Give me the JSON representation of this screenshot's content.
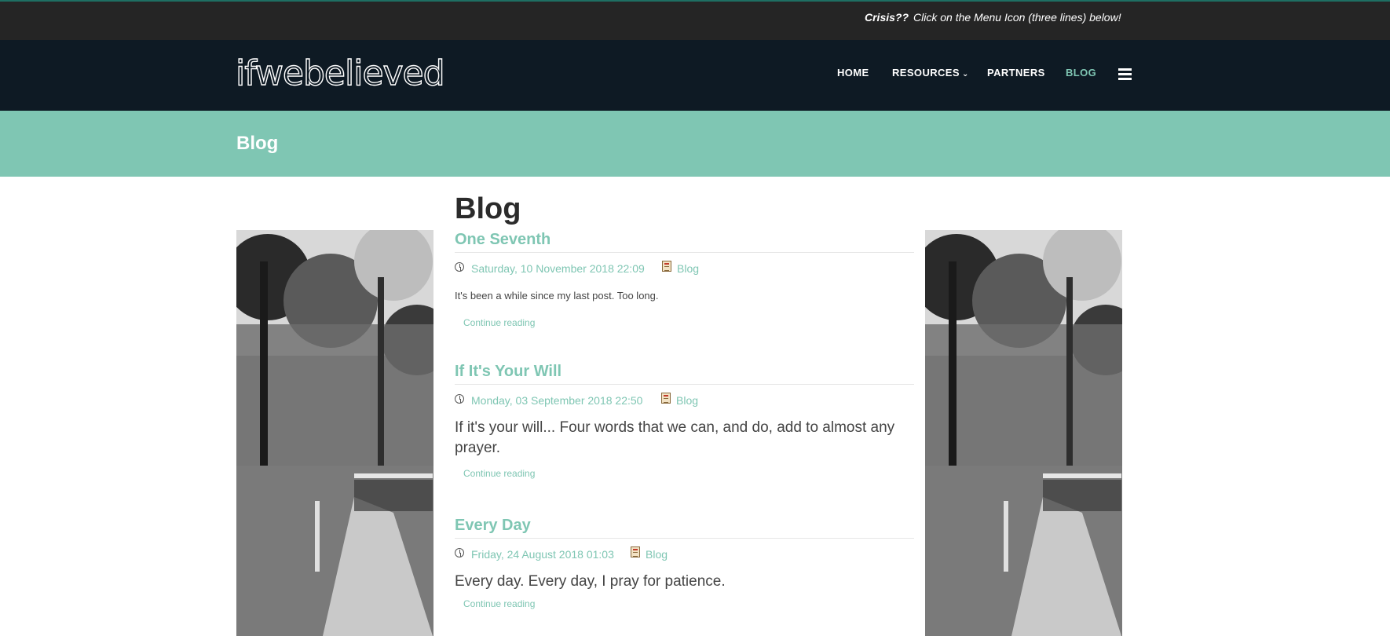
{
  "topbar": {
    "crisis_label": "Crisis??",
    "message": "Click on the Menu Icon (three lines) below!"
  },
  "header": {
    "logo_text": "ifwebelieved",
    "nav": [
      {
        "label": "HOME",
        "active": false
      },
      {
        "label": "RESOURCES",
        "active": false,
        "has_dropdown": true
      },
      {
        "label": "PARTNERS",
        "active": false
      },
      {
        "label": "BLOG",
        "active": true
      }
    ],
    "menu_icon": "hamburger-icon"
  },
  "banner": {
    "title": "Blog"
  },
  "main": {
    "heading": "Blog",
    "continue_label": "Continue reading",
    "posts": [
      {
        "title": "One Seventh",
        "date": "Saturday, 10 November 2018 22:09",
        "category": "Blog",
        "excerpt": "It's been a while since my last post.  Too long."
      },
      {
        "title": "If It's Your Will",
        "date": "Monday, 03 September 2018 22:50",
        "category": "Blog",
        "excerpt": "If it's your will... Four words that we can, and do, add to almost any prayer."
      },
      {
        "title": "Every Day",
        "date": "Friday, 24 August 2018 01:03",
        "category": "Blog",
        "excerpt": "Every day. Every day, I pray for patience."
      }
    ]
  },
  "colors": {
    "accent": "#7fc6b3",
    "topbar_bg": "#252525",
    "header_bg": "#0e1a24",
    "heading_text": "#2b2b2b"
  },
  "icons": [
    "clock-icon",
    "category-icon",
    "hamburger-icon",
    "chevron-down-icon"
  ]
}
